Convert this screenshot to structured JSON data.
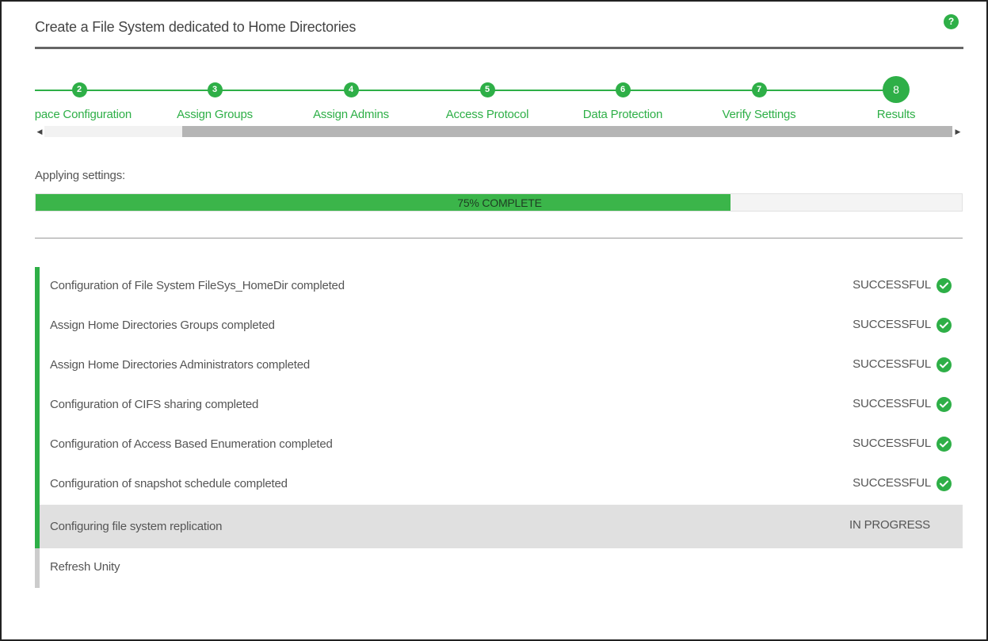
{
  "window": {
    "title": "Create a File System dedicated to Home Directories",
    "help_icon": "?"
  },
  "stepper": {
    "steps": [
      {
        "number": "2",
        "label": "Space Configuration",
        "state": "completed"
      },
      {
        "number": "3",
        "label": "Assign Groups",
        "state": "completed"
      },
      {
        "number": "4",
        "label": "Assign Admins",
        "state": "completed"
      },
      {
        "number": "5",
        "label": "Access Protocol",
        "state": "completed"
      },
      {
        "number": "6",
        "label": "Data Protection",
        "state": "completed"
      },
      {
        "number": "7",
        "label": "Verify Settings",
        "state": "completed"
      },
      {
        "number": "8",
        "label": "Results",
        "state": "current"
      }
    ],
    "scroll_left_icon": "◀",
    "scroll_right_icon": "▶"
  },
  "progress": {
    "heading": "Applying settings:",
    "percent": 75,
    "text": "75% COMPLETE"
  },
  "tasks": [
    {
      "label": "Configuration of File System FileSys_HomeDir completed",
      "status": "SUCCESSFUL",
      "state": "done"
    },
    {
      "label": "Assign Home Directories Groups completed",
      "status": "SUCCESSFUL",
      "state": "done"
    },
    {
      "label": "Assign Home Directories Administrators completed",
      "status": "SUCCESSFUL",
      "state": "done"
    },
    {
      "label": "Configuration of CIFS sharing completed",
      "status": "SUCCESSFUL",
      "state": "done"
    },
    {
      "label": "Configuration of Access Based Enumeration completed",
      "status": "SUCCESSFUL",
      "state": "done"
    },
    {
      "label": "Configuration of snapshot schedule completed",
      "status": "SUCCESSFUL",
      "state": "done"
    },
    {
      "label": "Configuring file system replication",
      "status": "IN PROGRESS",
      "state": "active"
    },
    {
      "label": "Refresh Unity",
      "status": "",
      "state": "pending"
    }
  ],
  "colors": {
    "accent": "#2eaf47",
    "progress_fill": "#3bb54a",
    "active_row": "#e0e0e0",
    "pending_bar": "#cccccc"
  }
}
